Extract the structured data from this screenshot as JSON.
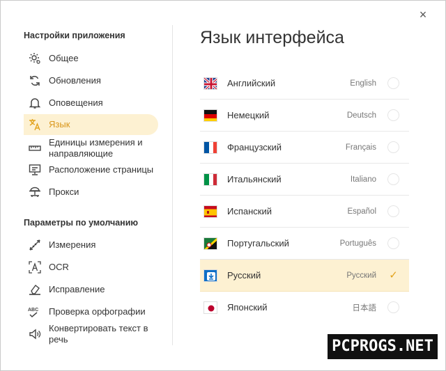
{
  "close_icon": "×",
  "sidebar": {
    "app_settings_title": "Настройки приложения",
    "app_items": [
      {
        "label": "Общее",
        "icon": "gear-icon"
      },
      {
        "label": "Обновления",
        "icon": "refresh-icon"
      },
      {
        "label": "Оповещения",
        "icon": "bell-icon"
      },
      {
        "label": "Язык",
        "icon": "language-icon",
        "active": true
      },
      {
        "label": "Единицы измерения и направляющие",
        "icon": "ruler-icon"
      },
      {
        "label": "Расположение страницы",
        "icon": "page-layout-icon"
      },
      {
        "label": "Прокси",
        "icon": "proxy-icon"
      }
    ],
    "defaults_title": "Параметры по умолчанию",
    "default_items": [
      {
        "label": "Измерения",
        "icon": "measure-icon"
      },
      {
        "label": "OCR",
        "icon": "ocr-icon"
      },
      {
        "label": "Исправление",
        "icon": "eraser-icon"
      },
      {
        "label": "Проверка орфографии",
        "icon": "spellcheck-icon"
      },
      {
        "label": "Конвертировать текст в речь",
        "icon": "speaker-icon"
      }
    ]
  },
  "main": {
    "title": "Язык интерфейса",
    "languages": [
      {
        "name": "Английский",
        "native": "English",
        "flag": "uk-flag-icon",
        "selected": false
      },
      {
        "name": "Немецкий",
        "native": "Deutsch",
        "flag": "germany-flag-icon",
        "selected": false
      },
      {
        "name": "Французский",
        "native": "Français",
        "flag": "france-flag-icon",
        "selected": false
      },
      {
        "name": "Итальянский",
        "native": "Italiano",
        "flag": "italy-flag-icon",
        "selected": false
      },
      {
        "name": "Испанский",
        "native": "Español",
        "flag": "spain-flag-icon",
        "selected": false
      },
      {
        "name": "Португальский",
        "native": "Português",
        "flag": "portugal-flag-icon",
        "selected": false
      },
      {
        "name": "Русский",
        "native": "Русский",
        "flag": "russian-flag-icon",
        "selected": true
      },
      {
        "name": "Японский",
        "native": "日本語",
        "flag": "japan-flag-icon",
        "selected": false
      }
    ]
  },
  "colors": {
    "accent": "#e2a21b",
    "active_bg": "#fdf1d2"
  },
  "watermark": "PCPROGS.NET"
}
